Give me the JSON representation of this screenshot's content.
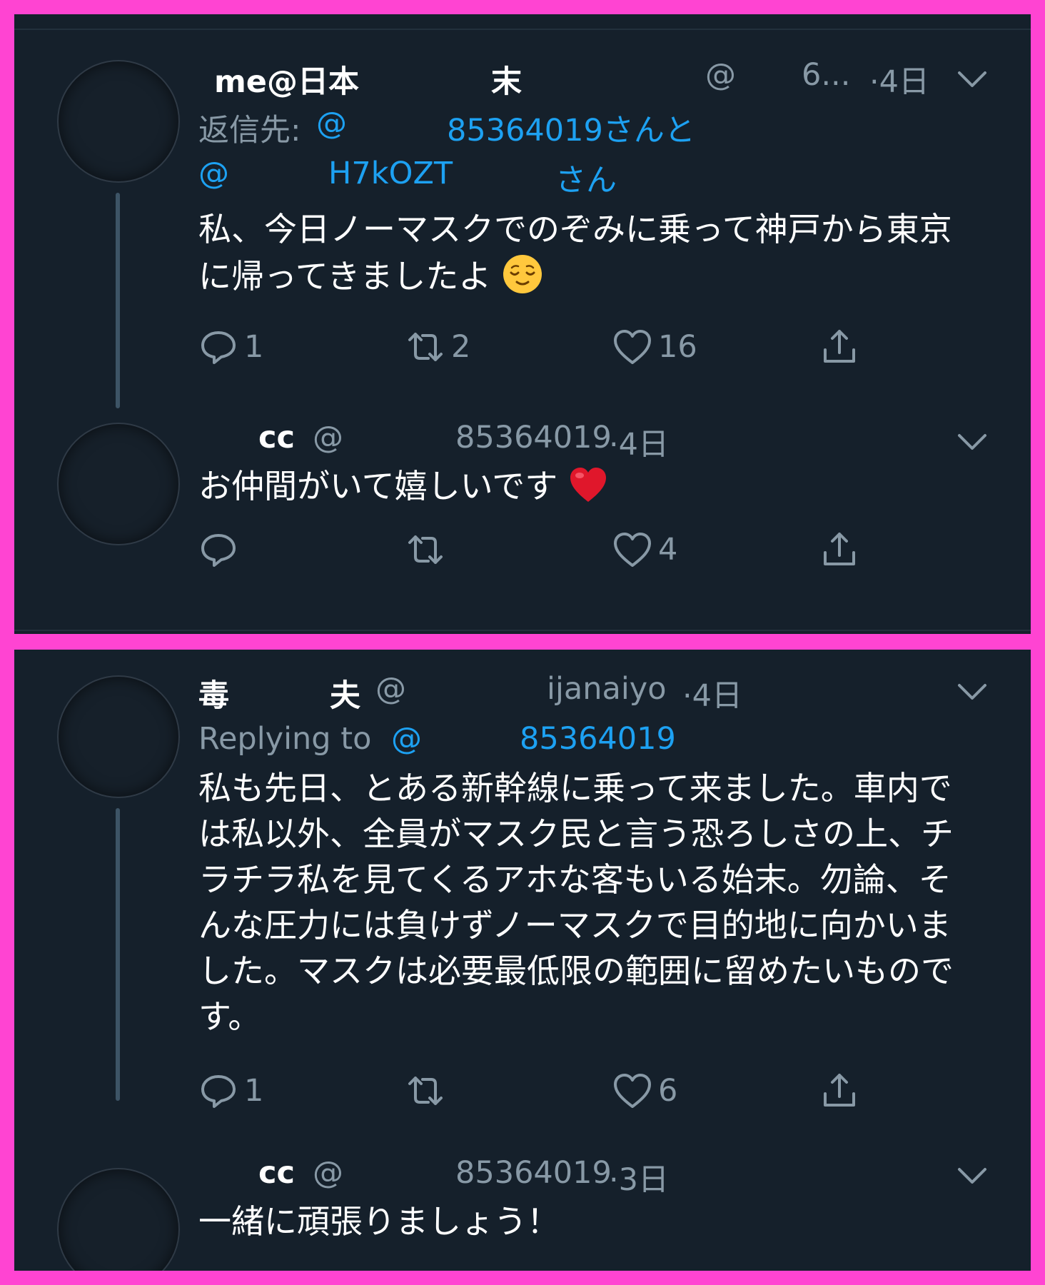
{
  "panel1": {
    "tweet1": {
      "name_a": "me@日本",
      "name_b": "末",
      "at": "@",
      "handle_trunc": "6...",
      "sep_time": "·4日",
      "reply_label": "返信先:",
      "reply_at1": "@",
      "reply_handle1": "85364019さんと",
      "reply_at2": "@",
      "reply_handle2": "H7kOZT",
      "reply_suffix2": "さん",
      "body_line1": "私、今日ノーマスクでのぞみに乗って神戸から東京",
      "body_line2": "に帰ってきましたよ",
      "emoji": "relieved-face",
      "replies": "1",
      "retweets": "2",
      "likes": "16"
    },
    "tweet2": {
      "name": "cc",
      "at": "@",
      "handle": "85364019",
      "sep_time": "·4日",
      "body": "お仲間がいて嬉しいです",
      "emoji": "red-heart",
      "likes": "4"
    }
  },
  "panel2": {
    "tweet3": {
      "name_a": "毒",
      "name_b": "夫",
      "at": "@",
      "handle": "ijanaiyo",
      "sep_time": "·4日",
      "reply_label": "Replying to",
      "reply_at": "@",
      "reply_handle": "85364019",
      "body_lines": [
        "私も先日、とある新幹線に乗って来ました。車内で",
        "は私以外、全員がマスク民と言う恐ろしさの上、チ",
        "ラチラ私を見てくるアホな客もいる始末。勿論、そ",
        "んな圧力には負けずノーマスクで目的地に向かいま",
        "した。マスクは必要最低限の範囲に留めたいもので",
        "す。"
      ],
      "replies": "1",
      "likes": "6"
    },
    "tweet4": {
      "name": "cc",
      "at": "@",
      "handle": "85364019",
      "sep_time": "·3日",
      "body": "一緒に頑張りましょう！"
    }
  },
  "colors": {
    "frame": "#ff44d2",
    "background": "#15202b",
    "link": "#1da1f2",
    "muted": "#8899a6",
    "text": "#ffffff"
  }
}
